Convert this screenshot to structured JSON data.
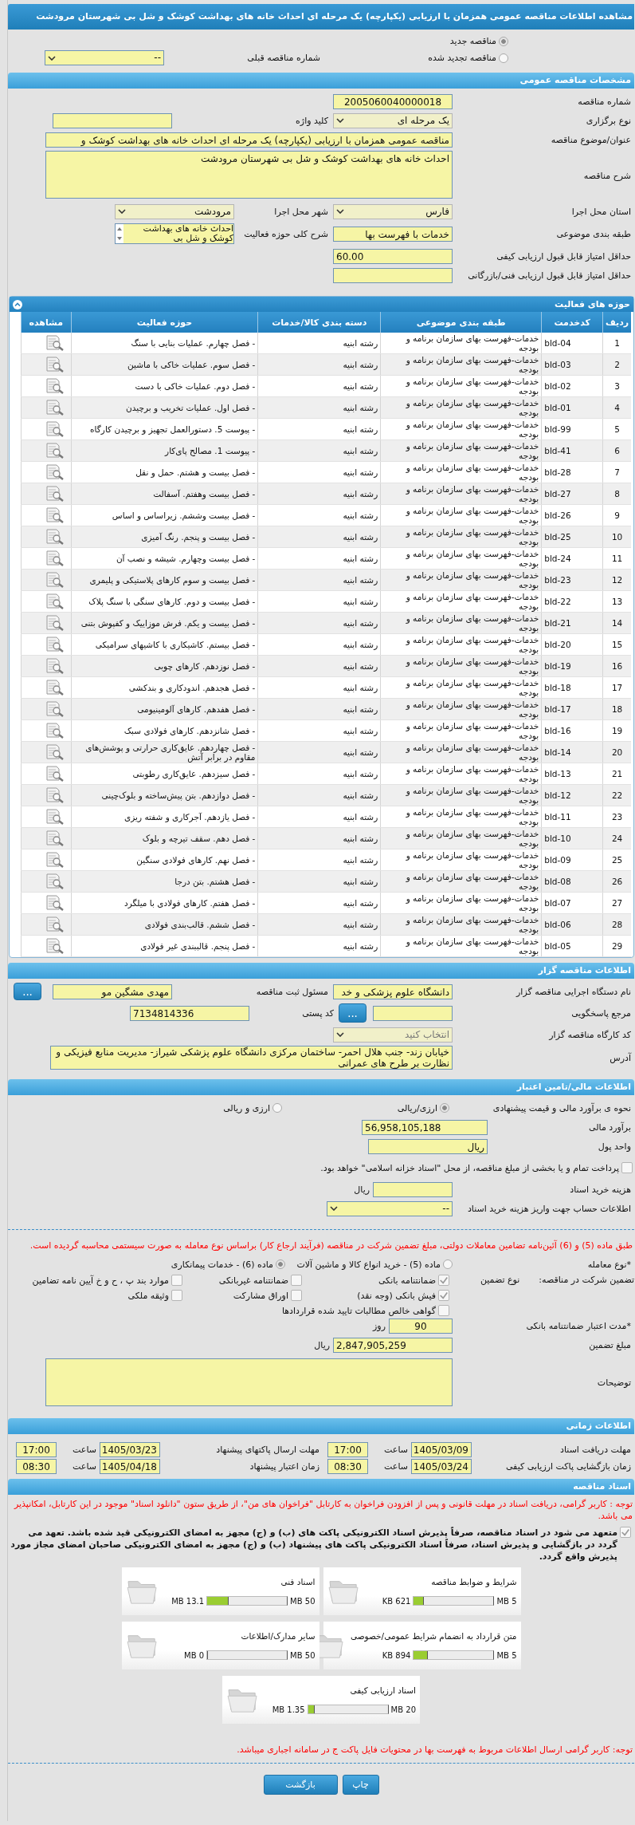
{
  "page_title": "مشاهده اطلاعات مناقصه عمومی همزمان با ارزیابی (یکپارچه) یک مرحله ای احداث خانه های بهداشت کوشک و شل بی شهرستان مرودشت",
  "tender_mode": [
    {
      "label": "مناقصه جدید",
      "selected": true
    },
    {
      "label": "مناقصه تجدید شده",
      "selected": false
    }
  ],
  "previous_tender": {
    "label": "شماره مناقصه قبلی",
    "value": "--"
  },
  "general": {
    "title": "مشخصات مناقصه عمومی",
    "tender_number": {
      "label": "شماره مناقصه",
      "value": "2005060040000018"
    },
    "holding_type": {
      "label": "نوع برگزاری",
      "value": "یک مرحله ای"
    },
    "keyword": {
      "label": "کلید واژه"
    },
    "subject": {
      "label": "عنوان/موضوع مناقصه",
      "value": "مناقصه عمومی همزمان با ارزیابی (یکپارچه) یک مرحله ای احداث خانه های بهداشت کوشک و"
    },
    "description": {
      "label": "شرح مناقصه",
      "value": "احداث خانه های بهداشت کوشک و شل بی شهرستان مرودشت"
    },
    "province": {
      "label": "استان محل اجرا",
      "value": "فارس"
    },
    "city": {
      "label": "شهر محل اجرا",
      "value": "مرودشت"
    },
    "category": {
      "label": "طبقه بندی موضوعی",
      "value": "خدمات با فهرست بها"
    },
    "activity_scope": {
      "label": "شرح کلی حوزه فعالیت",
      "value": "احداث خانه های بهداشت کوشک و شل بی"
    },
    "min_quality_score": {
      "label": "حداقل امتیاز قابل قبول ارزیابی کیفی",
      "value": "60.00"
    },
    "min_technical_score": {
      "label": "حداقل امتیاز قابل قبول ارزیابی فنی/بازرگانی"
    }
  },
  "activities": {
    "title": "حوزه های فعالیت",
    "columns": [
      "ردیف",
      "کدخدمت",
      "طبقه بندی موضوعی",
      "دسته بندی کالا/خدمات",
      "حوزه فعالیت",
      "مشاهده"
    ],
    "rows": [
      {
        "index": "1",
        "code": "bld-04",
        "category": "خدمات-فهرست بهای سازمان برنامه و بودجه",
        "goods": "رشته ابنیه",
        "activity": "- فصل چهارم. عملیات بنایی با سنگ"
      },
      {
        "index": "2",
        "code": "bld-03",
        "category": "خدمات-فهرست بهای سازمان برنامه و بودجه",
        "goods": "رشته ابنیه",
        "activity": "- فصل سوم. عملیات خاکی با ماشین"
      },
      {
        "index": "3",
        "code": "bld-02",
        "category": "خدمات-فهرست بهای سازمان برنامه و بودجه",
        "goods": "رشته ابنیه",
        "activity": "- فصل دوم. عملیات خاکی با دست"
      },
      {
        "index": "4",
        "code": "bld-01",
        "category": "خدمات-فهرست بهای سازمان برنامه و بودجه",
        "goods": "رشته ابنیه",
        "activity": "- فصل اول. عملیات تخریب و برچیدن"
      },
      {
        "index": "5",
        "code": "bld-99",
        "category": "خدمات-فهرست بهای سازمان برنامه و بودجه",
        "goods": "رشته ابنیه",
        "activity": "- پیوست 5. دستورالعمل تجهیز و برچیدن کارگاه"
      },
      {
        "index": "6",
        "code": "bld-41",
        "category": "خدمات-فهرست بهای سازمان برنامه و بودجه",
        "goods": "رشته ابنیه",
        "activity": "- پیوست 1. مصالح پای‌کار"
      },
      {
        "index": "7",
        "code": "bld-28",
        "category": "خدمات-فهرست بهای سازمان برنامه و بودجه",
        "goods": "رشته ابنیه",
        "activity": "- فصل بیست و هشتم. حمل و نقل"
      },
      {
        "index": "8",
        "code": "bld-27",
        "category": "خدمات-فهرست بهای سازمان برنامه و بودجه",
        "goods": "رشته ابنیه",
        "activity": "- فصل بیست وهفتم. آسفالت"
      },
      {
        "index": "9",
        "code": "bld-26",
        "category": "خدمات-فهرست بهای سازمان برنامه و بودجه",
        "goods": "رشته ابنیه",
        "activity": "- فصل بیست وششم. زیراساس و اساس"
      },
      {
        "index": "10",
        "code": "bld-25",
        "category": "خدمات-فهرست بهای سازمان برنامه و بودجه",
        "goods": "رشته ابنیه",
        "activity": "- فصل بیست و پنجم. رنگ آمیزی"
      },
      {
        "index": "11",
        "code": "bld-24",
        "category": "خدمات-فهرست بهای سازمان برنامه و بودجه",
        "goods": "رشته ابنیه",
        "activity": "- فصل بیست وچهارم. شیشه و نصب آن"
      },
      {
        "index": "12",
        "code": "bld-23",
        "category": "خدمات-فهرست بهای سازمان برنامه و بودجه",
        "goods": "رشته ابنیه",
        "activity": "- فصل بیست و سوم کارهای پلاستیکی و پلیمری"
      },
      {
        "index": "13",
        "code": "bld-22",
        "category": "خدمات-فهرست بهای سازمان برنامه و بودجه",
        "goods": "رشته ابنیه",
        "activity": "- فصل بیست و دوم. کارهای سنگی با سنگ پلاک"
      },
      {
        "index": "14",
        "code": "bld-21",
        "category": "خدمات-فهرست بهای سازمان برنامه و بودجه",
        "goods": "رشته ابنیه",
        "activity": "- فصل بیست و یکم. فرش موزاییک و کفپوش بتنی"
      },
      {
        "index": "15",
        "code": "bld-20",
        "category": "خدمات-فهرست بهای سازمان برنامه و بودجه",
        "goods": "رشته ابنیه",
        "activity": "- فصل بیستم. کاشیکاری با کاشیهای سرامیکی"
      },
      {
        "index": "16",
        "code": "bld-19",
        "category": "خدمات-فهرست بهای سازمان برنامه و بودجه",
        "goods": "رشته ابنیه",
        "activity": "- فصل نوزدهم. کارهای چوبی"
      },
      {
        "index": "17",
        "code": "bld-18",
        "category": "خدمات-فهرست بهای سازمان برنامه و بودجه",
        "goods": "رشته ابنیه",
        "activity": "- فصل هجدهم. اندودکاری و بندکشی"
      },
      {
        "index": "18",
        "code": "bld-17",
        "category": "خدمات-فهرست بهای سازمان برنامه و بودجه",
        "goods": "رشته ابنیه",
        "activity": "- فصل هفدهم. کارهای آلومینیومی"
      },
      {
        "index": "19",
        "code": "bld-16",
        "category": "خدمات-فهرست بهای سازمان برنامه و بودجه",
        "goods": "رشته ابنیه",
        "activity": "- فصل شانزدهم. کارهای فولادی سبک"
      },
      {
        "index": "20",
        "code": "bld-14",
        "category": "خدمات-فهرست بهای سازمان برنامه و بودجه",
        "goods": "رشته ابنیه",
        "activity": "- فصل چهاردهم. عایق‌کاری حرارتی و پوشش‌های مقاوم در برابر آتش"
      },
      {
        "index": "21",
        "code": "bld-13",
        "category": "خدمات-فهرست بهای سازمان برنامه و بودجه",
        "goods": "رشته ابنیه",
        "activity": "- فصل سیزدهم. عایق‌کاری رطوبتی"
      },
      {
        "index": "22",
        "code": "bld-12",
        "category": "خدمات-فهرست بهای سازمان برنامه و بودجه",
        "goods": "رشته ابنیه",
        "activity": "- فصل دوازدهم. بتن پیش‌ساخته و بلوک‌چینی"
      },
      {
        "index": "23",
        "code": "bld-11",
        "category": "خدمات-فهرست بهای سازمان برنامه و بودجه",
        "goods": "رشته ابنیه",
        "activity": "- فصل یازدهم. آجرکاری و شفته ریزی"
      },
      {
        "index": "24",
        "code": "bld-10",
        "category": "خدمات-فهرست بهای سازمان برنامه و بودجه",
        "goods": "رشته ابنیه",
        "activity": "- فصل دهم. سقف تیرچه و بلوک"
      },
      {
        "index": "25",
        "code": "bld-09",
        "category": "خدمات-فهرست بهای سازمان برنامه و بودجه",
        "goods": "رشته ابنیه",
        "activity": "- فصل نهم. کارهای فولادی سنگین"
      },
      {
        "index": "26",
        "code": "bld-08",
        "category": "خدمات-فهرست بهای سازمان برنامه و بودجه",
        "goods": "رشته ابنیه",
        "activity": "- فصل هشتم. بتن درجا"
      },
      {
        "index": "27",
        "code": "bld-07",
        "category": "خدمات-فهرست بهای سازمان برنامه و بودجه",
        "goods": "رشته ابنیه",
        "activity": "- فصل هفتم. کارهای فولادی با میلگرد"
      },
      {
        "index": "28",
        "code": "bld-06",
        "category": "خدمات-فهرست بهای سازمان برنامه و بودجه",
        "goods": "رشته ابنیه",
        "activity": "- فصل ششم. قالب‌بندی فولادی"
      },
      {
        "index": "29",
        "code": "bld-05",
        "category": "خدمات-فهرست بهای سازمان برنامه و بودجه",
        "goods": "رشته ابنیه",
        "activity": "- فصل پنجم. قالببندی غیر فولادی"
      }
    ]
  },
  "organizer": {
    "title": "اطلاعات مناقصه گزار",
    "org_name": {
      "label": "نام دستگاه اجرایی مناقصه گزار",
      "value": "دانشگاه علوم پزشکی و خد"
    },
    "registrar": {
      "label": "مسئول ثبت مناقصه",
      "value": "مهدی مشگین مو",
      "button": "..."
    },
    "responder": {
      "label": "مرجع پاسخگویی",
      "button": "..."
    },
    "postal_code": {
      "label": "کد پستی",
      "value": "7134814336"
    },
    "workshop_code": {
      "label": "کد کارگاه مناقصه گزار",
      "placeholder": "انتخاب کنید"
    },
    "address": {
      "label": "آدرس",
      "value": "خیابان زند- جنب هلال احمر- ساختمان مرکزی دانشگاه علوم پزشکی شیراز- مدیریت منابع فیزیکی و نظارت بر طرح های عمرانی"
    }
  },
  "finance": {
    "title": "اطلاعات مالی/تامین اعتبار",
    "pricing": {
      "label": "نحوه ی برآورد مالی و قیمت پیشنهادی",
      "options": [
        {
          "label": "ارزی/ریالی",
          "selected": true
        },
        {
          "label": "ارزی و ریالی",
          "selected": false
        }
      ]
    },
    "estimate": {
      "label": "برآورد مالی",
      "value": "56,958,105,188"
    },
    "currency": {
      "label": "واحد پول",
      "value": "ریال"
    },
    "islamic_treasury": {
      "label": "پرداخت تمام و یا بخشی از مبلغ مناقصه، از محل \"اسناد خزانه اسلامی\" خواهد بود.",
      "checked": false
    },
    "document_fee": {
      "label": "هزینه خرید اسناد",
      "unit": "ریال"
    },
    "fee_account": {
      "label": "اطلاعات حساب جهت واریز هزینه خرید اسناد",
      "value": "--"
    }
  },
  "guarantee": {
    "notice": "طبق ماده (5) و (6) آئین‌نامه تضامین معاملات دولتی، مبلغ تضمین شرکت در مناقصه (فرآیند ارجاع کار) براساس نوع معامله به صورت سیستمی محاسبه گردیده است.",
    "deal_type": {
      "mark": "*",
      "label": "نوع معامله",
      "options": [
        {
          "label": "ماده (5) - خرید انواع کالا و ماشین آلات",
          "selected": false
        },
        {
          "label": "ماده (6) - خدمات پیمانکاری",
          "selected": true
        }
      ]
    },
    "heading": "تضمین شرکت در مناقصه:",
    "type_label": "نوع تضمین",
    "types": [
      {
        "label": "ضمانتنامه بانکی",
        "checked": true
      },
      {
        "label": "ضمانتنامه غیربانکی",
        "checked": false
      },
      {
        "label": "موارد بند پ ، ح و خ آیین نامه تضامین",
        "checked": false
      },
      {
        "label": "فیش بانکی (وجه نقد)",
        "checked": true
      },
      {
        "label": "اوراق مشارکت",
        "checked": false
      },
      {
        "label": "وثیقه ملکی",
        "checked": false
      },
      {
        "label": "گواهی خالص مطالبات تایید شده قراردادها",
        "checked": false
      }
    ],
    "validity": {
      "mark": "*",
      "label": "مدت اعتبار ضمانتنامه بانکی",
      "value": "90",
      "unit": "روز"
    },
    "amount": {
      "label": "مبلغ تضمین",
      "value": "2,847,905,259",
      "unit": "ریال"
    },
    "notes": {
      "label": "توضیحات"
    }
  },
  "timing": {
    "title": "اطلاعات زمانی",
    "items": [
      {
        "label": "مهلت دریافت اسناد",
        "date": "1405/03/09",
        "time_label": "ساعت",
        "time": "17:00"
      },
      {
        "label": "مهلت ارسال پاکتهای پیشنهاد",
        "date": "1405/03/23",
        "time_label": "ساعت",
        "time": "17:00"
      },
      {
        "label": "زمان بازگشایی پاکت ارزیابی کیفی",
        "date": "1405/03/24",
        "time_label": "ساعت",
        "time": "08:30"
      },
      {
        "label": "زمان اعتبار پیشنهاد",
        "date": "1405/04/18",
        "time_label": "ساعت",
        "time": "08:30"
      }
    ]
  },
  "documents": {
    "title": "اسناد مناقصه",
    "notice": "توجه : کاربر گرامی، دریافت اسناد در مهلت قانونی و پس از افزودن فراخوان به کارتابل \"فراخوان های من\"، از طریق ستون \"دانلود اسناد\" موجود در این کارتابل، امکانپذیر می باشد.",
    "commitment": {
      "checked": true,
      "text": "متعهد می شود در اسناد مناقصه، صرفاً پذیرش اسناد الکترونیکی پاکت های (ب) و (ج) مجهز به امضای الکترونیکی قید شده باشد. تعهد می گردد در بازگشایی و پذیرش اسناد، صرفاً اسناد الکترونیکی پاکت های پیشنهاد (ب) و (ج) مجهز به امضای الکترونیکی صاحبان امضای مجاز مورد پذیرش واقع گردد."
    },
    "files": [
      {
        "name": "شرایط و ضوابط مناقصه",
        "limit": "5 MB",
        "size": "621 KB",
        "level": 0.12
      },
      {
        "name": "اسناد فنی",
        "limit": "50 MB",
        "size": "13.1 MB",
        "level": 0.26
      },
      {
        "name": "متن قرارداد به انضمام شرایط عمومی/خصوصی",
        "limit": "5 MB",
        "size": "894 KB",
        "level": 0.17
      },
      {
        "name": "سایر مدارک/اطلاعات",
        "limit": "50 MB",
        "size": "0 MB",
        "level": 0
      },
      {
        "name": "اسناد ارزیابی کیفی",
        "limit": "20 MB",
        "size": "1.35 MB",
        "level": 0.07
      }
    ],
    "final_notice": "توجه: کاربر گرامی ارسال اطلاعات مربوط به فهرست بها در محتویات فایل پاکت ج در سامانه اجباری میباشد."
  },
  "buttons": [
    "چاپ",
    "بازگشت"
  ]
}
